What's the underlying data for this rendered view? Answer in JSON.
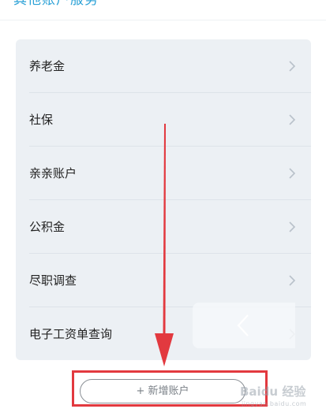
{
  "header": {
    "section_title": "其他账户服务"
  },
  "services": {
    "items": [
      {
        "label": "养老金",
        "icon": "chevron-right-icon"
      },
      {
        "label": "社保",
        "icon": "chevron-right-icon"
      },
      {
        "label": "亲亲账户",
        "icon": "chevron-right-icon"
      },
      {
        "label": "公积金",
        "icon": "chevron-right-icon"
      },
      {
        "label": "尽职调查",
        "icon": "chevron-right-icon"
      },
      {
        "label": "电子工资单查询",
        "icon": "chevron-right-icon"
      }
    ]
  },
  "actions": {
    "add_account_label": "+ 新增账户"
  },
  "overlay": {
    "back_icon": "chevron-left-icon"
  },
  "annotation": {
    "arrow_color": "#e2393f",
    "highlight_color": "#e2393f"
  },
  "watermark": {
    "logo_text": "Baidu 经验",
    "sub_text": "jingyan.baidu.com"
  },
  "colors": {
    "accent": "#29a0d6",
    "card_bg": "#ecf0f4"
  }
}
